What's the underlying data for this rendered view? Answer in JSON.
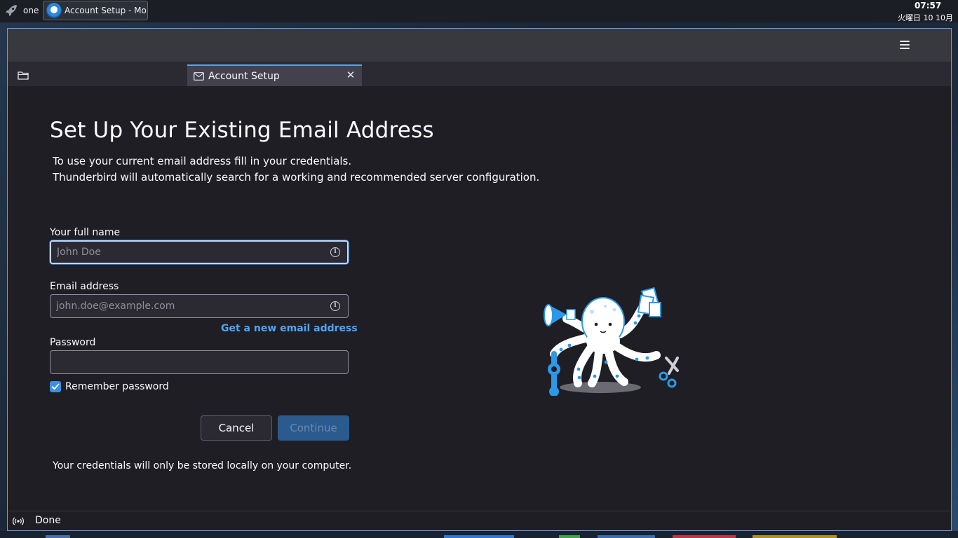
{
  "panel": {
    "workspace": "one",
    "task_title": "Account Setup - Mo...",
    "time": "07:57",
    "date": "火曜日 10 10月"
  },
  "window": {
    "tab_label": "Account Setup"
  },
  "form": {
    "heading": "Set Up Your Existing Email Address",
    "intro_line1": "To use your current email address fill in your credentials.",
    "intro_line2": "Thunderbird will automatically search for a working and recommended server configuration.",
    "name_label": "Your full name",
    "name_placeholder": "John Doe",
    "name_value": "",
    "email_label": "Email address",
    "email_placeholder": "john.doe@example.com",
    "email_value": "",
    "new_email_link": "Get a new email address",
    "password_label": "Password",
    "password_value": "",
    "remember_label": "Remember password",
    "remember_checked": true,
    "cancel_label": "Cancel",
    "continue_label": "Continue",
    "continue_enabled": false,
    "footnote": "Your credentials will only be stored locally on your computer."
  },
  "status": {
    "text": "Done"
  },
  "icons": {
    "launcher": "rocket-icon",
    "task": "thunderbird-icon",
    "menu": "hamburger-menu-icon",
    "folder": "folder-icon",
    "tab": "account-setup-icon",
    "close": "close-icon",
    "info": "info-icon",
    "checkbox": "checkmark-icon",
    "status": "wireless-status-icon",
    "illustration": "octopus-mascot"
  },
  "colors": {
    "accent": "#4da6f7",
    "primary_button": "#2b5a8f",
    "window_border": "#6b9be6",
    "background": "#1f1e25"
  }
}
